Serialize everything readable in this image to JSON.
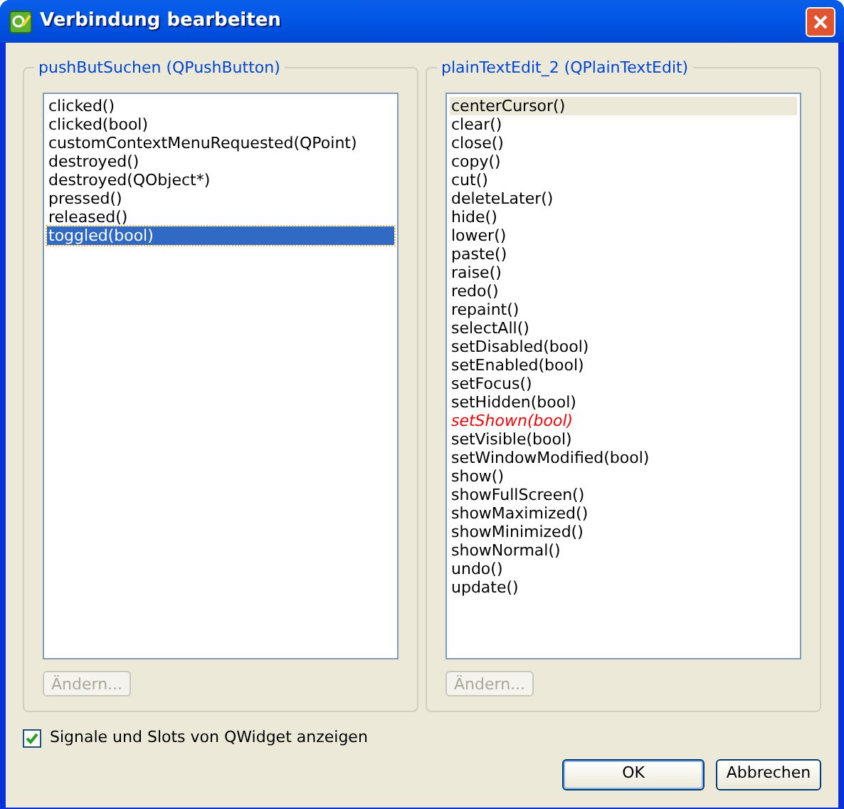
{
  "window": {
    "title": "Verbindung bearbeiten"
  },
  "left_group": {
    "title": "pushButSuchen (QPushButton)",
    "items": [
      {
        "label": "clicked()",
        "selected": false
      },
      {
        "label": "clicked(bool)",
        "selected": false
      },
      {
        "label": "customContextMenuRequested(QPoint)",
        "selected": false
      },
      {
        "label": "destroyed()",
        "selected": false
      },
      {
        "label": "destroyed(QObject*)",
        "selected": false
      },
      {
        "label": "pressed()",
        "selected": false
      },
      {
        "label": "released()",
        "selected": false
      },
      {
        "label": "toggled(bool)",
        "selected": true
      }
    ],
    "edit_button": {
      "label": "Ändern...",
      "disabled": true
    }
  },
  "right_group": {
    "title": "plainTextEdit_2 (QPlainTextEdit)",
    "items": [
      {
        "label": "centerCursor()",
        "current": true,
        "emphasized": false
      },
      {
        "label": "clear()",
        "current": false,
        "emphasized": false
      },
      {
        "label": "close()",
        "current": false,
        "emphasized": false
      },
      {
        "label": "copy()",
        "current": false,
        "emphasized": false
      },
      {
        "label": "cut()",
        "current": false,
        "emphasized": false
      },
      {
        "label": "deleteLater()",
        "current": false,
        "emphasized": false
      },
      {
        "label": "hide()",
        "current": false,
        "emphasized": false
      },
      {
        "label": "lower()",
        "current": false,
        "emphasized": false
      },
      {
        "label": "paste()",
        "current": false,
        "emphasized": false
      },
      {
        "label": "raise()",
        "current": false,
        "emphasized": false
      },
      {
        "label": "redo()",
        "current": false,
        "emphasized": false
      },
      {
        "label": "repaint()",
        "current": false,
        "emphasized": false
      },
      {
        "label": "selectAll()",
        "current": false,
        "emphasized": false
      },
      {
        "label": "setDisabled(bool)",
        "current": false,
        "emphasized": false
      },
      {
        "label": "setEnabled(bool)",
        "current": false,
        "emphasized": false
      },
      {
        "label": "setFocus()",
        "current": false,
        "emphasized": false
      },
      {
        "label": "setHidden(bool)",
        "current": false,
        "emphasized": false
      },
      {
        "label": "setShown(bool)",
        "current": false,
        "emphasized": true
      },
      {
        "label": "setVisible(bool)",
        "current": false,
        "emphasized": false
      },
      {
        "label": "setWindowModified(bool)",
        "current": false,
        "emphasized": false
      },
      {
        "label": "show()",
        "current": false,
        "emphasized": false
      },
      {
        "label": "showFullScreen()",
        "current": false,
        "emphasized": false
      },
      {
        "label": "showMaximized()",
        "current": false,
        "emphasized": false
      },
      {
        "label": "showMinimized()",
        "current": false,
        "emphasized": false
      },
      {
        "label": "showNormal()",
        "current": false,
        "emphasized": false
      },
      {
        "label": "undo()",
        "current": false,
        "emphasized": false
      },
      {
        "label": "update()",
        "current": false,
        "emphasized": false
      }
    ],
    "edit_button": {
      "label": "Ändern...",
      "disabled": true
    }
  },
  "checkbox": {
    "label": "Signale und Slots von QWidget anzeigen",
    "checked": true
  },
  "buttons": [
    {
      "label": "OK",
      "default": true
    },
    {
      "label": "Abbrechen",
      "default": false
    }
  ]
}
